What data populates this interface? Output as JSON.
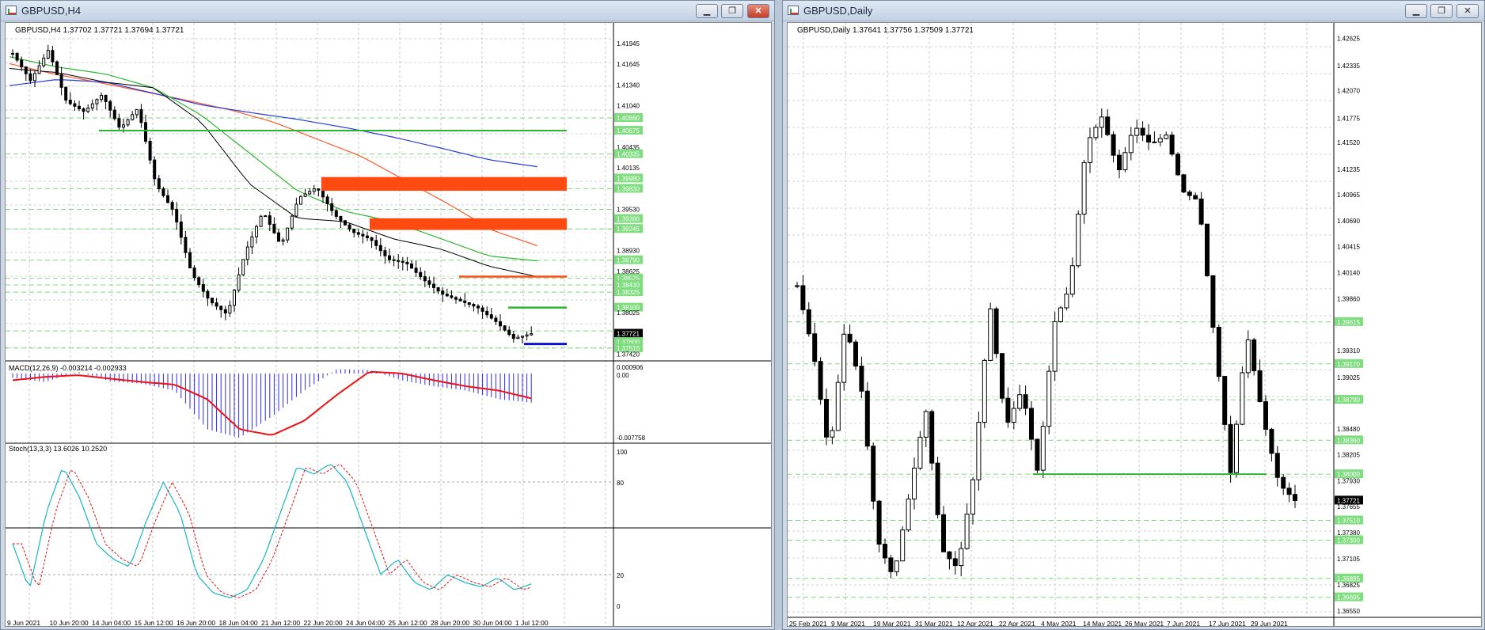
{
  "windows": {
    "left": {
      "title": "GBPUSD,H4",
      "header": "GBPUSD,H4  1.37702 1.37721 1.37694 1.37721",
      "price_labels": [
        "1.41945",
        "1.41645",
        "1.41340",
        "1.41040",
        "1.40860",
        "1.40675",
        "1.40435",
        "1.40335",
        "1.40135",
        "1.39980",
        "1.39830",
        "1.39530",
        "1.39390",
        "1.39245",
        "1.38930",
        "1.38790",
        "1.38625",
        "1.38525",
        "1.38430",
        "1.38325",
        "1.38100",
        "1.38025",
        "1.37721",
        "1.37600",
        "1.37510",
        "1.37420"
      ],
      "current_price": "1.37721",
      "time_labels": [
        "9 Jun 2021",
        "10 Jun 20:00",
        "14 Jun 04:00",
        "15 Jun 12:00",
        "16 Jun 20:00",
        "18 Jun 04:00",
        "21 Jun 12:00",
        "22 Jun 20:00",
        "24 Jun 04:00",
        "25 Jun 12:00",
        "28 Jun 20:00",
        "30 Jun 04:00",
        "1 Jul 12:00"
      ],
      "macd_header": "MACD(12,26,9) -0.003214 -0.002933",
      "macd_labels": [
        "0.000906",
        "0.00",
        "-0.007758"
      ],
      "stoch_header": "Stoch(13,3,3) 13.6026 10.2520",
      "stoch_labels": [
        "100",
        "80",
        "20",
        "0"
      ],
      "colors": {
        "zone": "#ff4a12",
        "green_line": "#2db52d",
        "blue_line": "#1010d0",
        "ma_red": "#ff5a2a",
        "ma_blue": "#2a3adb",
        "ma_green": "#2fb52f",
        "ma_black": "#000000",
        "macd_hist": "#2a2aef",
        "macd_signal": "#ee1111",
        "stoch_main": "#19b7c4",
        "stoch_signal": "#e01010"
      }
    },
    "right": {
      "title": "GBPUSD,Daily",
      "header": "GBPUSD,Daily  1.37641 1.37756 1.37509 1.37721",
      "price_labels": [
        "1.42625",
        "1.42335",
        "1.42070",
        "1.41775",
        "1.41520",
        "1.41235",
        "1.40965",
        "1.40690",
        "1.40415",
        "1.40140",
        "1.39860",
        "1.39615",
        "1.39310",
        "1.39170",
        "1.39025",
        "1.38790",
        "1.38480",
        "1.38360",
        "1.38205",
        "1.38000",
        "1.37930",
        "1.37721",
        "1.37655",
        "1.37510",
        "1.37380",
        "1.37300",
        "1.37105",
        "1.36895",
        "1.36825",
        "1.36695",
        "1.36550"
      ],
      "current_price": "1.37721",
      "time_labels": [
        "25 Feb 2021",
        "9 Mar 2021",
        "19 Mar 2021",
        "31 Mar 2021",
        "12 Apr 2021",
        "22 Apr 2021",
        "4 May 2021",
        "14 May 2021",
        "26 May 2021",
        "7 Jun 2021",
        "17 Jun 2021",
        "29 Jun 2021"
      ]
    }
  },
  "buttons": {
    "minimize": "▁",
    "restore": "❐",
    "close": "✕"
  }
}
